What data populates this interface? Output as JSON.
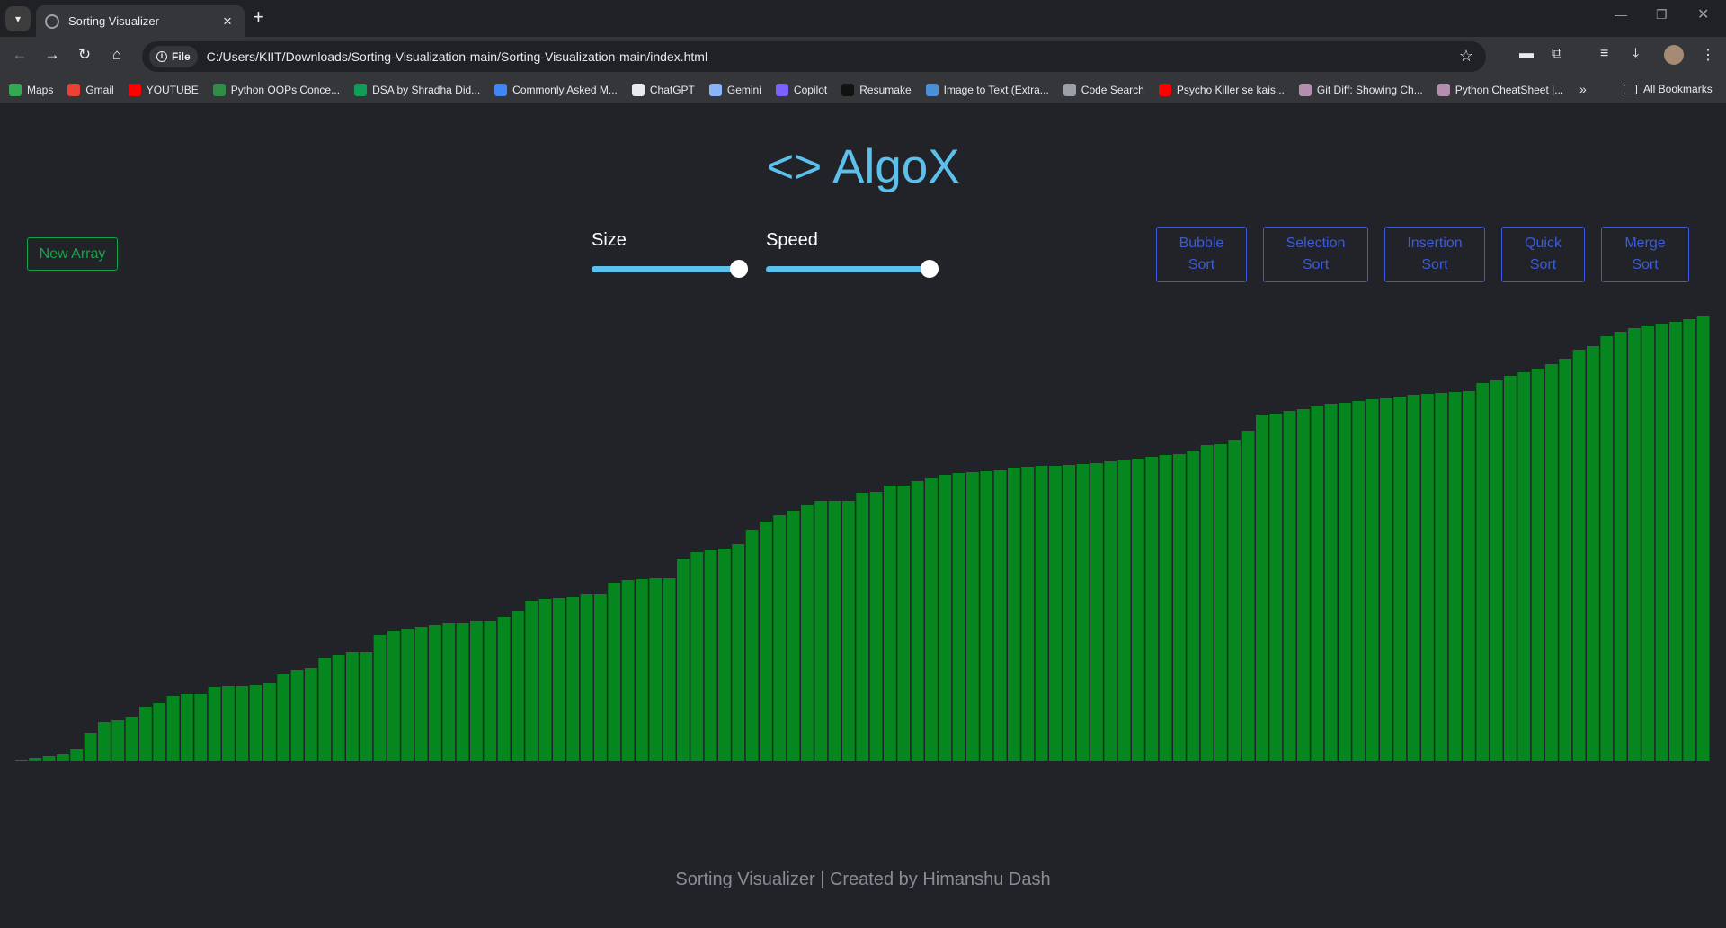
{
  "browser": {
    "tab_title": "Sorting Visualizer",
    "scheme_chip": "File",
    "url": "C:/Users/KIIT/Downloads/Sorting-Visualization-main/Sorting-Visualization-main/index.html",
    "bookmarks": [
      {
        "label": "Maps",
        "color": "#34a853"
      },
      {
        "label": "Gmail",
        "color": "#ea4335"
      },
      {
        "label": "YOUTUBE",
        "color": "#ff0000"
      },
      {
        "label": "Python OOPs Conce...",
        "color": "#2f8d46"
      },
      {
        "label": "DSA by Shradha Did...",
        "color": "#0f9d58"
      },
      {
        "label": "Commonly Asked M...",
        "color": "#4285f4"
      },
      {
        "label": "ChatGPT",
        "color": "#e8eaed"
      },
      {
        "label": "Gemini",
        "color": "#8ab4f8"
      },
      {
        "label": "Copilot",
        "color": "#7b61ff"
      },
      {
        "label": "Resumake",
        "color": "#111111"
      },
      {
        "label": "Image to Text (Extra...",
        "color": "#4a90d9"
      },
      {
        "label": "Code Search",
        "color": "#9aa0a6"
      },
      {
        "label": "Psycho Killer se kais...",
        "color": "#ff0000"
      },
      {
        "label": "Git Diff: Showing Ch...",
        "color": "#b48ead"
      },
      {
        "label": "Python CheatSheet |...",
        "color": "#b48ead"
      }
    ],
    "more_bookmarks": "»",
    "all_bookmarks": "All Bookmarks"
  },
  "app": {
    "title": "<> AlgoX",
    "new_array_label": "New Array",
    "size_label": "Size",
    "speed_label": "Speed",
    "size_value": 1.0,
    "speed_value": 1.0,
    "sort_buttons": [
      {
        "line1": "Bubble",
        "line2": "Sort"
      },
      {
        "line1": "Selection",
        "line2": "Sort"
      },
      {
        "line1": "Insertion",
        "line2": "Sort"
      },
      {
        "line1": "Quick",
        "line2": "Sort"
      },
      {
        "line1": "Merge",
        "line2": "Sort"
      }
    ],
    "footer": "Sorting Visualizer | Created by Himanshu Dash",
    "accent_color": "#5bc0eb",
    "bar_color": "#05861e",
    "button_color": "#3b5bdb",
    "new_array_color": "#16a34a"
  },
  "chart_data": {
    "type": "bar",
    "values": [
      1,
      3,
      5,
      7,
      13,
      31,
      43,
      45,
      49,
      60,
      64,
      72,
      74,
      74,
      82,
      83,
      83,
      84,
      86,
      96,
      101,
      103,
      114,
      118,
      121,
      121,
      140,
      144,
      147,
      149,
      151,
      153,
      153,
      155,
      155,
      160,
      166,
      178,
      180,
      181,
      182,
      185,
      185,
      198,
      201,
      202,
      203,
      203,
      224,
      232,
      234,
      236,
      241,
      257,
      266,
      273,
      278,
      284,
      289,
      289,
      289,
      298,
      299,
      306,
      306,
      311,
      314,
      318,
      320,
      321,
      322,
      323,
      326,
      327,
      328,
      328,
      329,
      330,
      331,
      333,
      335,
      336,
      338,
      340,
      341,
      345,
      351,
      352,
      357,
      367,
      385,
      386,
      389,
      391,
      394,
      397,
      398,
      400,
      402,
      403,
      405,
      407,
      408,
      409,
      410,
      411,
      420,
      423,
      428,
      432,
      436,
      441,
      447,
      457,
      461,
      472,
      477,
      481,
      484,
      486,
      488,
      491,
      495
    ]
  }
}
